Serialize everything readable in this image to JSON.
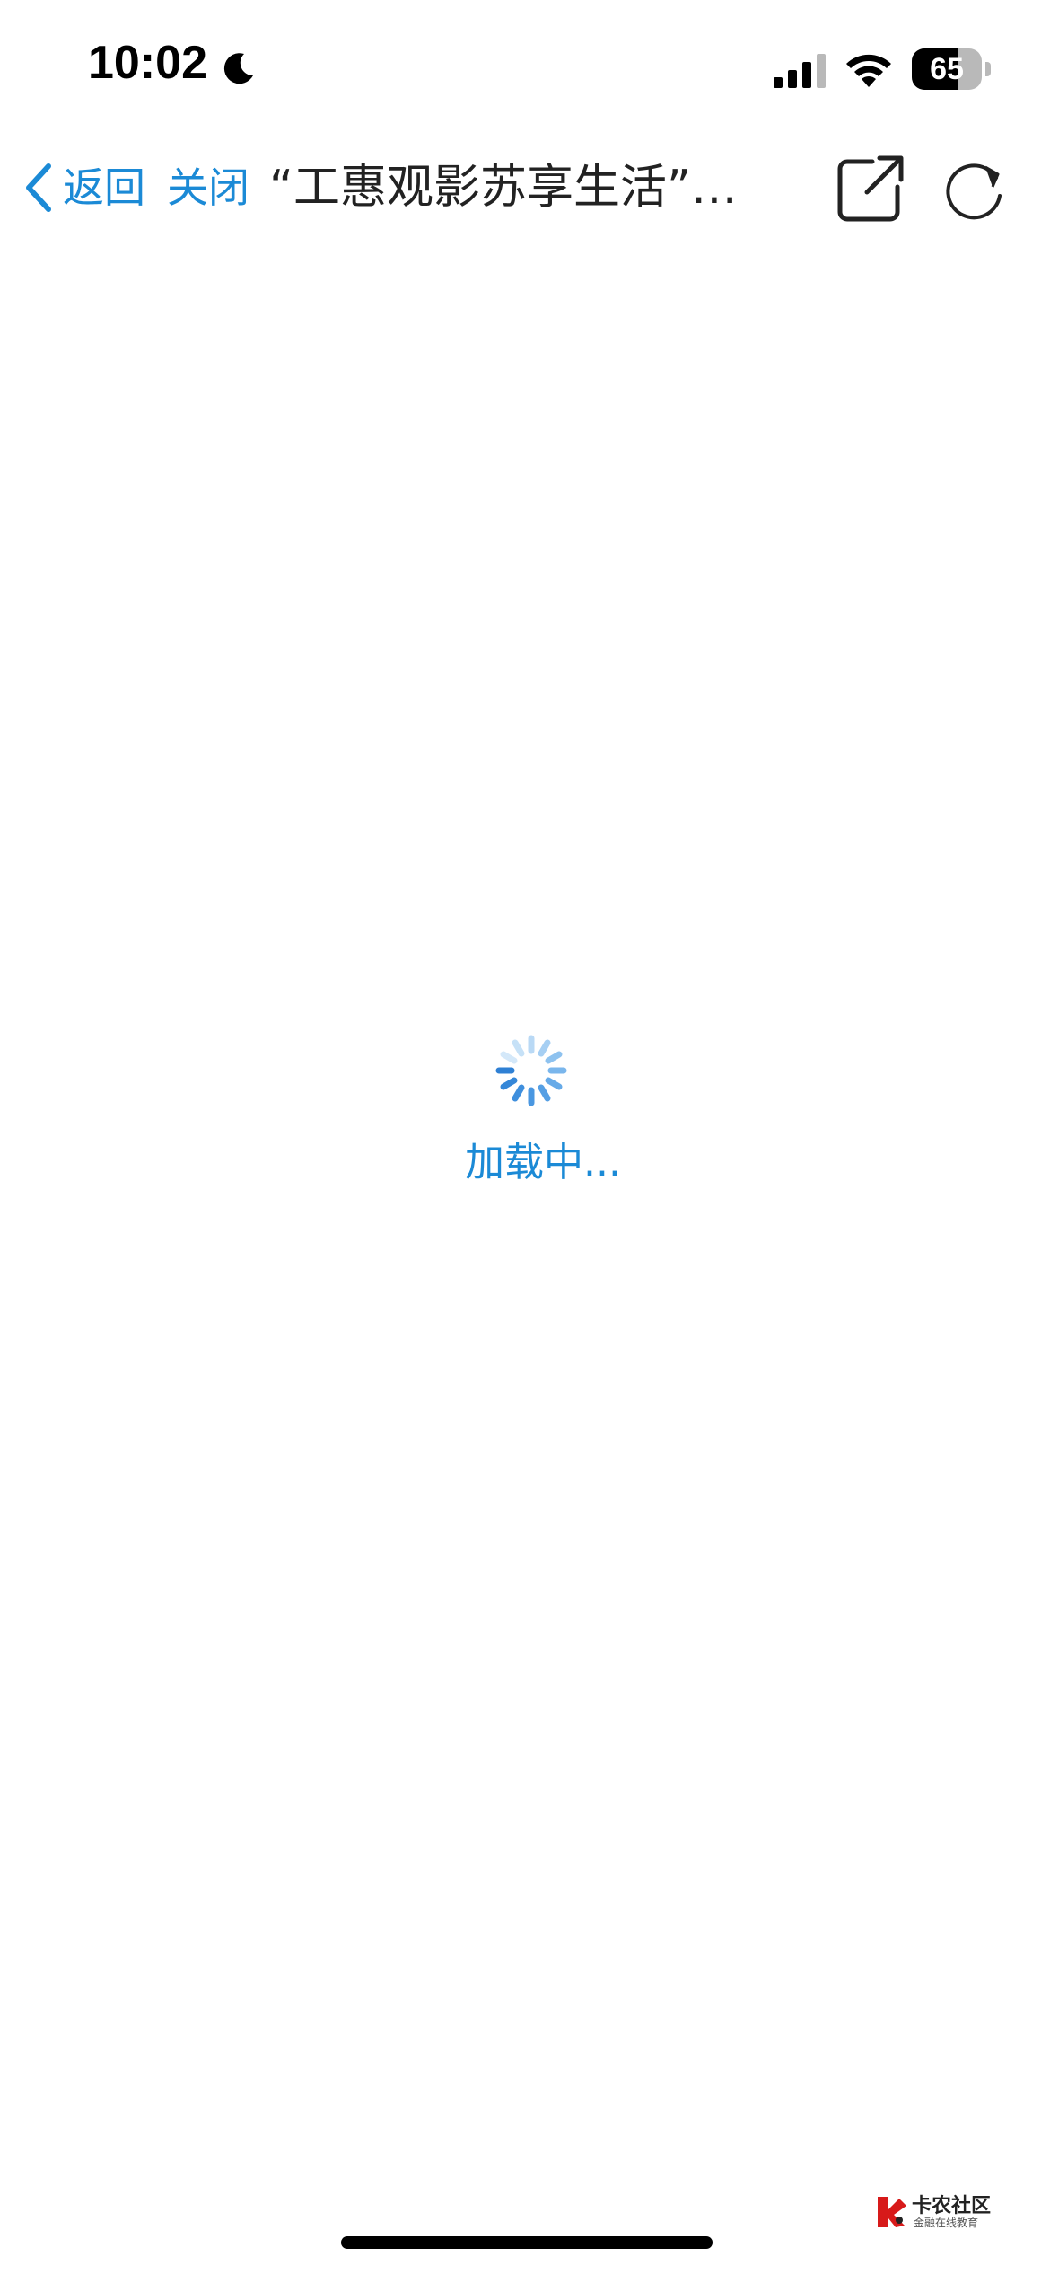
{
  "status_bar": {
    "time": "10:02",
    "battery_level": "65",
    "battery_fraction": 0.65
  },
  "nav": {
    "back_label": "返回",
    "close_label": "关闭",
    "title": "“工惠观影苏享生活”…"
  },
  "loading": {
    "text": "加载中..."
  },
  "watermark": {
    "title": "卡农社区",
    "subtitle": "金融在线教育"
  },
  "colors": {
    "accent": "#1b8ad6",
    "title": "#222222",
    "background": "#ffffff"
  },
  "icons": {
    "moon": "moon-icon",
    "signal": "cellular-signal-icon",
    "wifi": "wifi-icon",
    "back": "chevron-left-icon",
    "share": "share-icon",
    "refresh": "refresh-icon",
    "spinner": "spinner-icon"
  }
}
